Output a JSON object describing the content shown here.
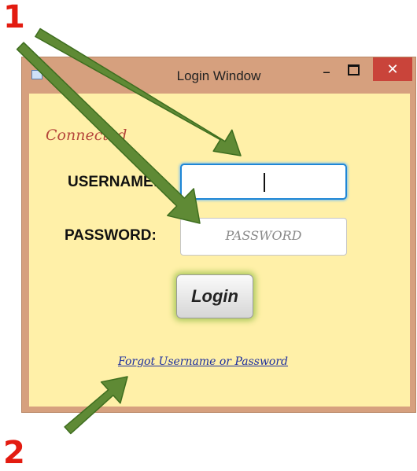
{
  "annotations": {
    "marker_1": "1",
    "marker_2": "2",
    "arrow_color": "#5f8a35"
  },
  "window": {
    "title": "Login Window",
    "minimize_glyph": "–",
    "close_glyph": "✕",
    "close_color": "#c9443a",
    "frame_color": "#d6a07e"
  },
  "form": {
    "status_text": "Connected",
    "status_color": "#b5473c",
    "username_label": "USERNAME:",
    "username_value": "",
    "password_label": "PASSWORD:",
    "password_placeholder": "PASSWORD",
    "login_label": "Login",
    "forgot_link": "Forgot Username or Password",
    "background_color": "#fff0a8"
  }
}
